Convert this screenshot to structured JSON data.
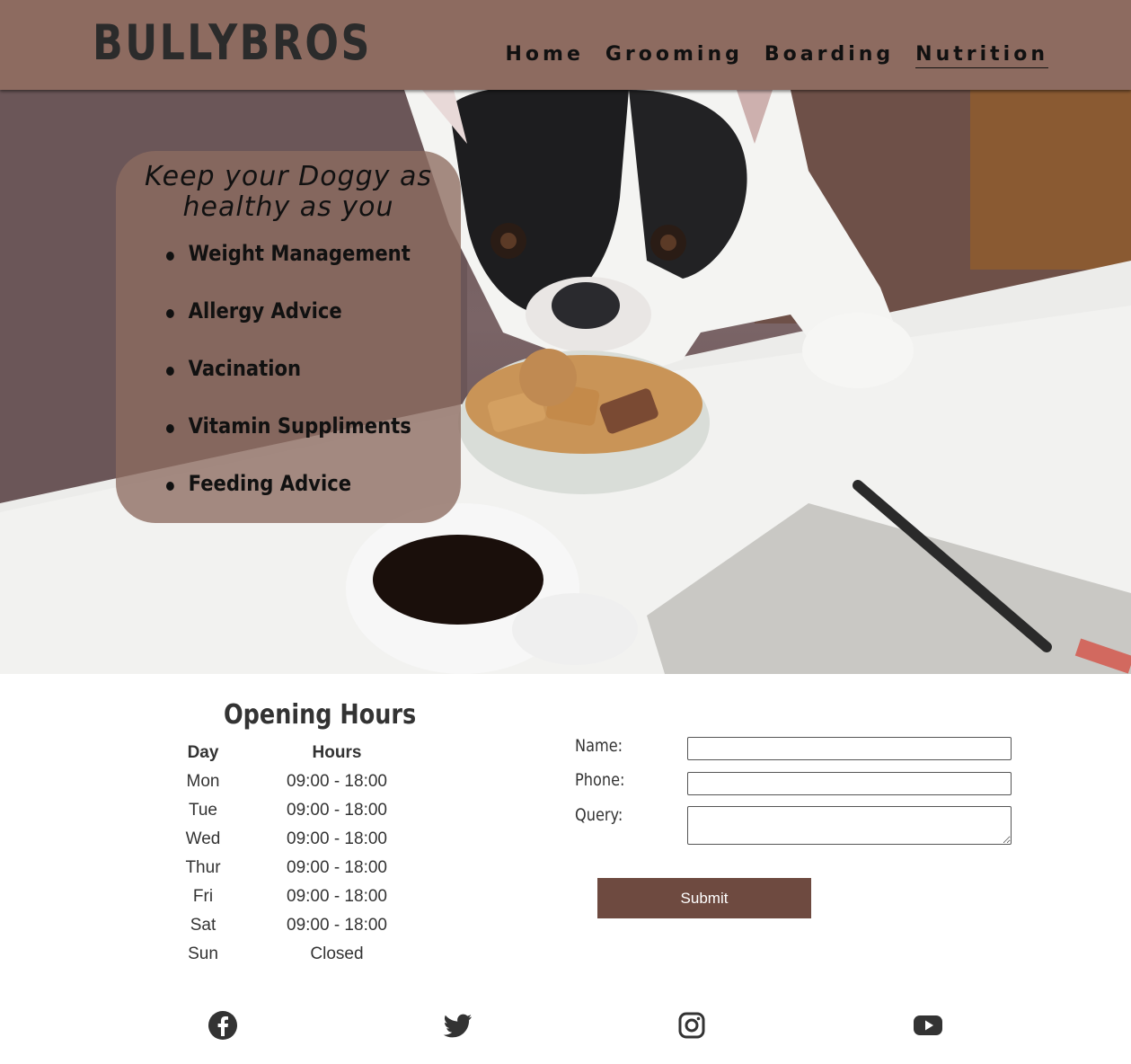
{
  "header": {
    "logo": "BULLYBROS",
    "nav": [
      "Home",
      "Grooming",
      "Boarding",
      "Nutrition"
    ],
    "active": "Nutrition"
  },
  "hero": {
    "title": "Keep your Doggy as healthy as you",
    "items": [
      "Weight Management",
      "Allergy Advice",
      "Vacination",
      "Vitamin Suppliments",
      "Feeding Advice"
    ]
  },
  "hours": {
    "title": "Opening Hours",
    "head_day": "Day",
    "head_hours": "Hours",
    "rows": [
      {
        "day": "Mon",
        "time": "09:00 - 18:00"
      },
      {
        "day": "Tue",
        "time": "09:00 - 18:00"
      },
      {
        "day": "Wed",
        "time": "09:00 - 18:00"
      },
      {
        "day": "Thur",
        "time": "09:00 - 18:00"
      },
      {
        "day": "Fri",
        "time": "09:00 - 18:00"
      },
      {
        "day": "Sat",
        "time": "09:00 - 18:00"
      },
      {
        "day": "Sun",
        "time": "Closed"
      }
    ]
  },
  "form": {
    "name_label": "Name:",
    "phone_label": "Phone:",
    "query_label": "Query:",
    "name_value": "",
    "phone_value": "",
    "query_value": "",
    "submit": "Submit"
  },
  "social": [
    "facebook-icon",
    "twitter-icon",
    "instagram-icon",
    "youtube-icon"
  ],
  "colors": {
    "brand": "#8d6b60",
    "button": "#6e4a40"
  }
}
